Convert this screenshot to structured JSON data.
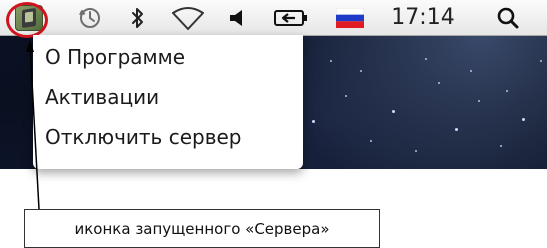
{
  "menubar": {
    "clock": "17:14",
    "icons": [
      "server-app-icon",
      "time-machine-icon",
      "bluetooth-icon",
      "wifi-icon",
      "volume-icon",
      "battery-icon",
      "input-flag-icon",
      "spotlight-icon"
    ],
    "colors": {
      "highlight_ring": "#d0141e"
    }
  },
  "menu": {
    "items": [
      "О Программе",
      "Активации",
      "Отключить сервер"
    ]
  },
  "callout": {
    "text": "иконка запущенного «Сервера»"
  }
}
